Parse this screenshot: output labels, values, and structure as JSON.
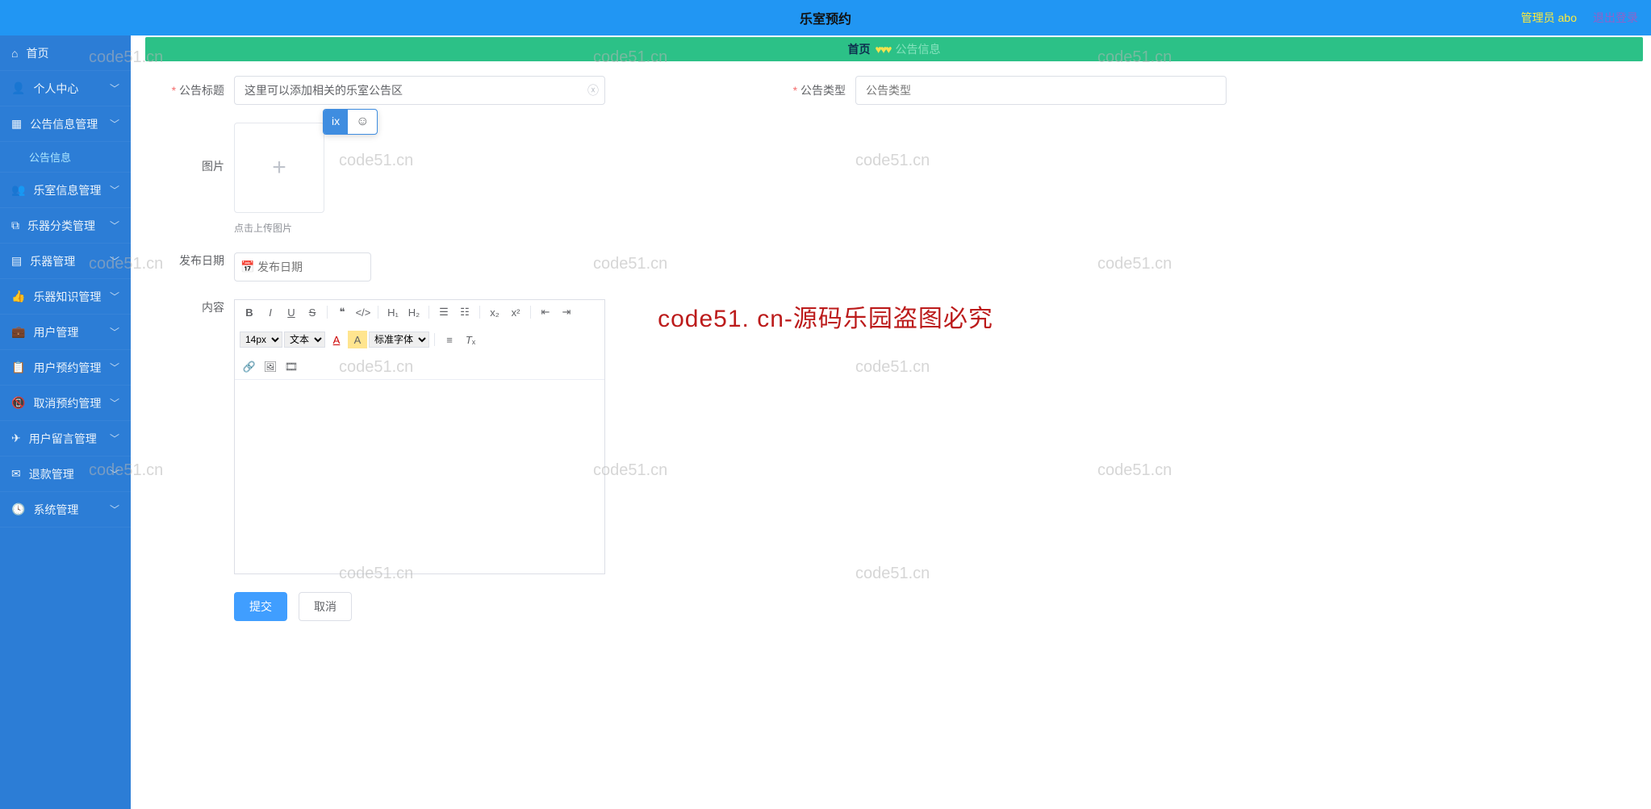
{
  "header": {
    "title": "乐室预约",
    "user_prefix": "管理员",
    "user_name": "abo",
    "exit": "退出登录"
  },
  "sidebar": {
    "items": [
      {
        "icon": "home",
        "label": "首页"
      },
      {
        "icon": "user",
        "label": "个人中心",
        "expand": true
      },
      {
        "icon": "grid",
        "label": "公告信息管理",
        "expand": true
      },
      {
        "icon": "",
        "label": "公告信息",
        "sub": true
      },
      {
        "icon": "users",
        "label": "乐室信息管理",
        "expand": true
      },
      {
        "icon": "copy",
        "label": "乐器分类管理",
        "expand": true
      },
      {
        "icon": "list",
        "label": "乐器管理",
        "expand": true
      },
      {
        "icon": "thumb",
        "label": "乐器知识管理",
        "expand": true
      },
      {
        "icon": "briefcase",
        "label": "用户管理",
        "expand": true
      },
      {
        "icon": "clipboard",
        "label": "用户预约管理",
        "expand": true
      },
      {
        "icon": "phone",
        "label": "取消预约管理",
        "expand": true
      },
      {
        "icon": "plane",
        "label": "用户留言管理",
        "expand": true
      },
      {
        "icon": "envelope",
        "label": "退款管理",
        "expand": true
      },
      {
        "icon": "clock",
        "label": "系统管理",
        "expand": true
      }
    ]
  },
  "breadcrumb": {
    "home": "首页",
    "current": "公告信息"
  },
  "form": {
    "title_label": "公告标题",
    "title_value": "这里可以添加相关的乐室公告区",
    "type_label": "公告类型",
    "type_placeholder": "公告类型",
    "image_label": "图片",
    "upload_tip": "点击上传图片",
    "date_label": "发布日期",
    "date_placeholder": "发布日期",
    "content_label": "内容",
    "submit": "提交",
    "cancel": "取消"
  },
  "editor_toolbar": {
    "fontsize": "14px",
    "text_dd": "文本",
    "fontfamily": "标准字体",
    "h1": "H₁",
    "h2": "H₂"
  },
  "ime": {
    "text": "ix",
    "emoji": "☺"
  },
  "watermark": {
    "site": "code51.cn",
    "center": "code51. cn-源码乐园盗图必究"
  }
}
